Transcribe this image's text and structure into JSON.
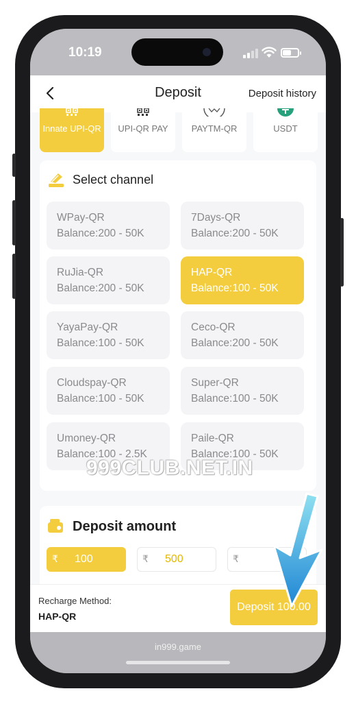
{
  "status_bar": {
    "time": "10:19"
  },
  "header": {
    "title": "Deposit",
    "history_label": "Deposit history"
  },
  "payment_tabs": [
    {
      "label": "Innate UPI-QR",
      "active": true
    },
    {
      "label": "UPI-QR PAY",
      "active": false
    },
    {
      "label": "PAYTM-QR",
      "active": false
    },
    {
      "label": "USDT",
      "active": false
    }
  ],
  "channel_section": {
    "title": "Select channel",
    "channels": [
      {
        "name": "WPay-QR",
        "balance": "Balance:200 - 50K",
        "selected": false
      },
      {
        "name": "7Days-QR",
        "balance": "Balance:200 - 50K",
        "selected": false
      },
      {
        "name": "RuJia-QR",
        "balance": "Balance:200 - 50K",
        "selected": false
      },
      {
        "name": "HAP-QR",
        "balance": "Balance:100 - 50K",
        "selected": true
      },
      {
        "name": "YayaPay-QR",
        "balance": "Balance:100 - 50K",
        "selected": false
      },
      {
        "name": "Ceco-QR",
        "balance": "Balance:200 - 50K",
        "selected": false
      },
      {
        "name": "Cloudspay-QR",
        "balance": "Balance:100 - 50K",
        "selected": false
      },
      {
        "name": "Super-QR",
        "balance": "Balance:100 - 50K",
        "selected": false
      },
      {
        "name": "Umoney-QR",
        "balance": "Balance:100 - 2.5K",
        "selected": false
      },
      {
        "name": "Paile-QR",
        "balance": "Balance:100 - 50K",
        "selected": false
      }
    ]
  },
  "watermark": "999CLUB.NET.IN",
  "amount_section": {
    "title": "Deposit amount",
    "currency_symbol": "₹",
    "amounts": [
      "100",
      "500",
      ""
    ]
  },
  "footer": {
    "method_label": "Recharge Method:",
    "method_value": "HAP-QR",
    "deposit_button": "Deposit 100.00"
  },
  "browser": {
    "url": "in999.game"
  },
  "colors": {
    "accent": "#f4cd3e",
    "arrow": "#2b8fd6"
  }
}
